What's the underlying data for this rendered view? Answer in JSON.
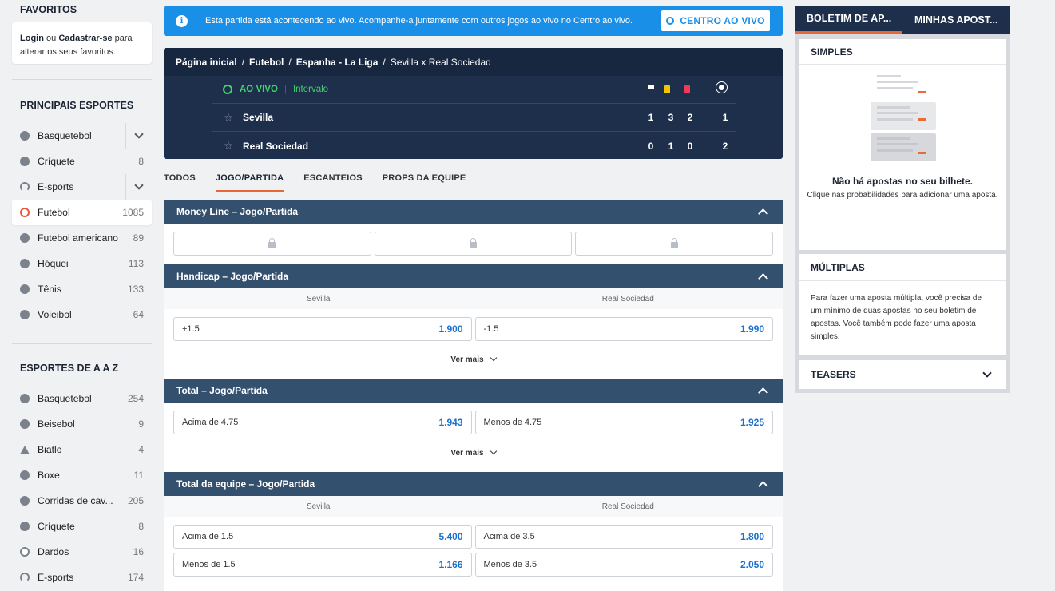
{
  "favorites": {
    "title": "FAVORITOS",
    "login": "Login",
    "or": "ou",
    "register": "Cadastrar-se",
    "text": "para alterar os seus favoritos."
  },
  "main_sports": {
    "title": "PRINCIPAIS ESPORTES",
    "items": [
      {
        "name": "Basquetebol",
        "count": "",
        "icon": "basketball-icon"
      },
      {
        "name": "Críquete",
        "count": "8",
        "icon": "cricket-icon"
      },
      {
        "name": "E-sports",
        "count": "",
        "icon": "headset-icon"
      },
      {
        "name": "Futebol",
        "count": "1085",
        "icon": "soccer-icon"
      },
      {
        "name": "Futebol americano",
        "count": "89",
        "icon": "football-icon"
      },
      {
        "name": "Hóquei",
        "count": "113",
        "icon": "hockey-icon"
      },
      {
        "name": "Tênis",
        "count": "133",
        "icon": "tennis-icon"
      },
      {
        "name": "Voleibol",
        "count": "64",
        "icon": "volleyball-icon"
      }
    ]
  },
  "az_sports": {
    "title": "ESPORTES DE A A Z",
    "items": [
      {
        "name": "Basquetebol",
        "count": "254",
        "icon": "basketball-icon"
      },
      {
        "name": "Beisebol",
        "count": "9",
        "icon": "baseball-icon"
      },
      {
        "name": "Biatlo",
        "count": "4",
        "icon": "biathlon-icon"
      },
      {
        "name": "Boxe",
        "count": "11",
        "icon": "boxing-icon"
      },
      {
        "name": "Corridas de cav...",
        "count": "205",
        "icon": "horse-racing-icon"
      },
      {
        "name": "Críquete",
        "count": "8",
        "icon": "cricket-icon"
      },
      {
        "name": "Dardos",
        "count": "16",
        "icon": "darts-icon"
      },
      {
        "name": "E-sports",
        "count": "174",
        "icon": "headset-icon"
      }
    ]
  },
  "banner": {
    "message": "Esta partida está acontecendo ao vivo. Acompanhe-a juntamente com outros jogos ao vivo no Centro ao vivo.",
    "button": "CENTRO AO VIVO"
  },
  "breadcrumb": [
    "Página inicial",
    "Futebol",
    "Espanha - La Liga",
    "Sevilla x Real Sociedad"
  ],
  "match": {
    "live": "AO VIVO",
    "status": "Intervalo",
    "teams": [
      {
        "name": "Sevilla",
        "corners": "1",
        "yellow": "3",
        "red": "2",
        "goals": "1"
      },
      {
        "name": "Real Sociedad",
        "corners": "0",
        "yellow": "1",
        "red": "0",
        "goals": "2"
      }
    ]
  },
  "tabs": [
    "TODOS",
    "JOGO/PARTIDA",
    "ESCANTEIOS",
    "PROPS DA EQUIPE"
  ],
  "markets": {
    "moneyline": {
      "title": "Money Line – Jogo/Partida"
    },
    "handicap": {
      "title": "Handicap – Jogo/Partida",
      "col1": "Sevilla",
      "col2": "Real Sociedad",
      "o1_label": "+1.5",
      "o1_value": "1.900",
      "o2_label": "-1.5",
      "o2_value": "1.990",
      "more": "Ver mais"
    },
    "total": {
      "title": "Total – Jogo/Partida",
      "o1_label": "Acima de 4.75",
      "o1_value": "1.943",
      "o2_label": "Menos de 4.75",
      "o2_value": "1.925",
      "more": "Ver mais"
    },
    "team_total": {
      "title": "Total da equipe – Jogo/Partida",
      "col1": "Sevilla",
      "col2": "Real Sociedad",
      "r1a_label": "Acima de 1.5",
      "r1a_value": "5.400",
      "r1b_label": "Acima de 3.5",
      "r1b_value": "1.800",
      "r2a_label": "Menos de 1.5",
      "r2a_value": "1.166",
      "r2b_label": "Menos de 3.5",
      "r2b_value": "2.050"
    }
  },
  "betslip": {
    "tab1": "BOLETIM DE AP...",
    "tab2": "MINHAS APOST...",
    "simples": "SIMPLES",
    "empty_title": "Não há apostas no seu bilhete.",
    "empty_sub": "Clique nas probabilidades para adicionar uma aposta.",
    "multiplas": "MÚLTIPLAS",
    "multiplas_text": "Para fazer uma aposta múltipla, você precisa de um mínimo de duas apostas no seu boletim de apostas. Você também pode fazer uma aposta simples.",
    "teasers": "TEASERS"
  },
  "colors": {
    "accent": "#e8663a",
    "live": "#3ed36b",
    "odds": "#1a6fd1",
    "banner": "#1a8fe8",
    "header": "#34506f"
  }
}
